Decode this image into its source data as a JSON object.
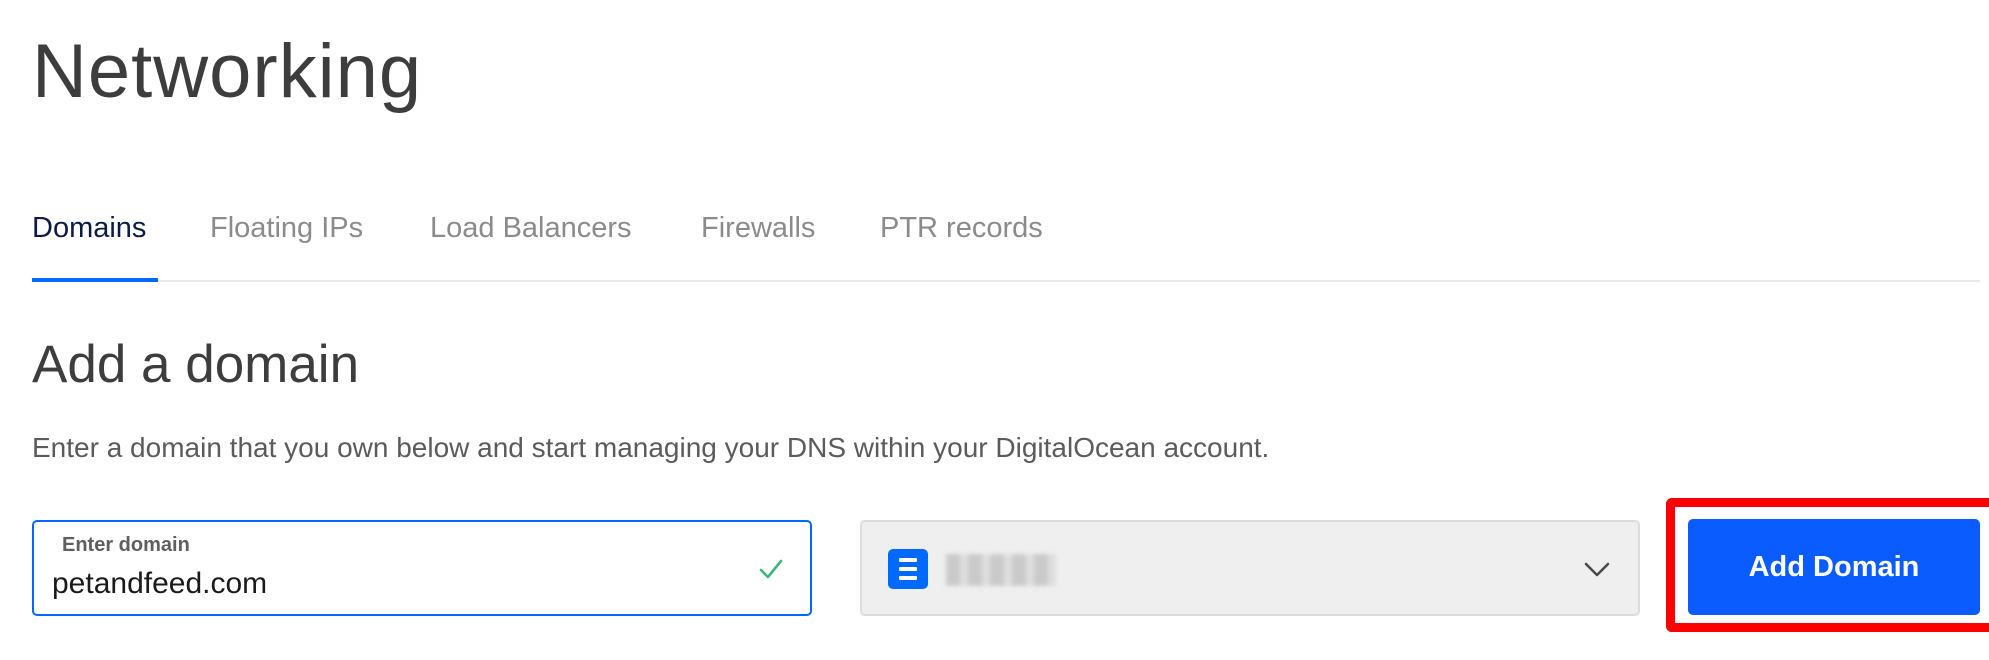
{
  "page": {
    "title": "Networking"
  },
  "tabs": [
    {
      "label": "Domains",
      "active": true
    },
    {
      "label": "Floating IPs",
      "active": false
    },
    {
      "label": "Load Balancers",
      "active": false
    },
    {
      "label": "Firewalls",
      "active": false
    },
    {
      "label": "PTR records",
      "active": false
    }
  ],
  "add_domain": {
    "title": "Add a domain",
    "description": "Enter a domain that you own below and start managing your DNS within your DigitalOcean account.",
    "domain_field": {
      "label": "Enter domain",
      "value": "petandfeed.com",
      "status_icon": "check-icon",
      "status_color": "#3bb77e"
    },
    "project_select": {
      "icon": "project-icon",
      "selected_value_redacted": true,
      "dropdown_icon": "chevron-down-icon"
    },
    "submit_button": {
      "label": "Add Domain",
      "highlighted": true
    }
  },
  "colors": {
    "accent": "#0069ff",
    "button": "#0a5cff",
    "highlight": "#ff0000",
    "active_tab_text": "#0b1b45",
    "inactive_tab_text": "#8b8b8b"
  }
}
